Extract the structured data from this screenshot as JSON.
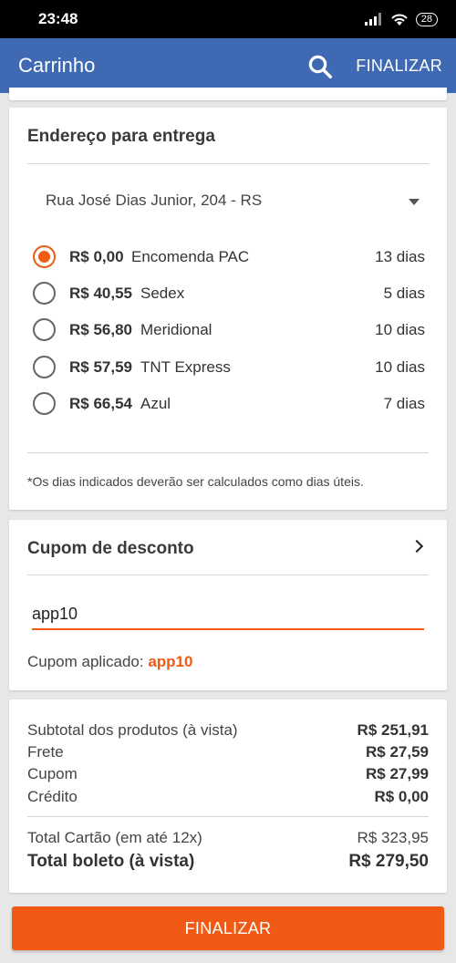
{
  "status_bar": {
    "time": "23:48",
    "battery": "28"
  },
  "app_bar": {
    "title": "Carrinho",
    "search_icon": "search-icon",
    "finalize_label": "FINALIZAR"
  },
  "address_section": {
    "title": "Endereço para entrega",
    "selected_address": "Rua José Dias Junior, 204 - RS",
    "shipping_options": [
      {
        "price": "R$ 0,00",
        "name": "Encomenda PAC",
        "days": "13 dias",
        "selected": true
      },
      {
        "price": "R$ 40,55",
        "name": "Sedex",
        "days": "5 dias",
        "selected": false
      },
      {
        "price": "R$ 56,80",
        "name": "Meridional",
        "days": "10 dias",
        "selected": false
      },
      {
        "price": "R$ 57,59",
        "name": "TNT Express",
        "days": "10 dias",
        "selected": false
      },
      {
        "price": "R$ 66,54",
        "name": "Azul",
        "days": "7 dias",
        "selected": false
      }
    ],
    "footnote": "*Os dias indicados deverão ser calculados como dias úteis."
  },
  "coupon_section": {
    "title": "Cupom de desconto",
    "input_value": "app10",
    "applied_label": "Cupom aplicado:",
    "applied_code": "app10"
  },
  "totals": {
    "subtotal_label": "Subtotal dos produtos (à vista)",
    "subtotal_value": "R$ 251,91",
    "frete_label": "Frete",
    "frete_value": "R$ 27,59",
    "cupom_label": "Cupom",
    "cupom_value": "R$ 27,99",
    "credito_label": "Crédito",
    "credito_value": "R$ 0,00",
    "cartao_label": "Total Cartão (em até 12x)",
    "cartao_value": "R$ 323,95",
    "boleto_label": "Total boleto (à vista)",
    "boleto_value": "R$ 279,50"
  },
  "finalize_button": "FINALIZAR",
  "colors": {
    "app_bar": "#3f69b3",
    "accent": "#f05a14",
    "background": "#e7e7e7"
  }
}
